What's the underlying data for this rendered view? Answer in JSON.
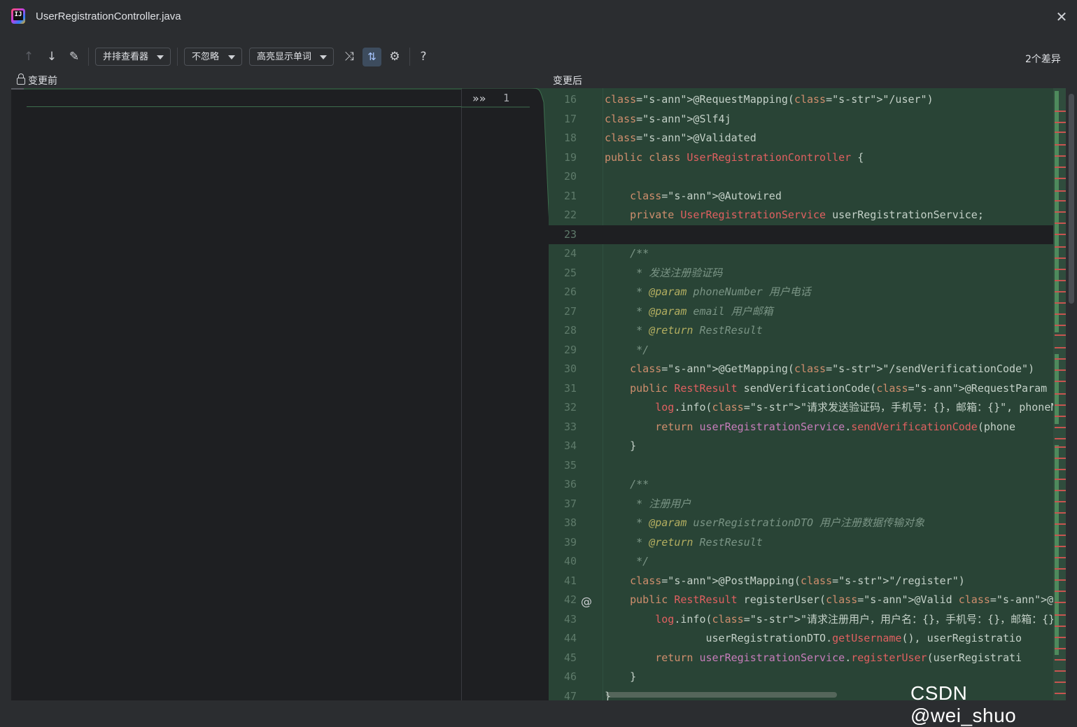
{
  "window": {
    "title": "UserRegistrationController.java",
    "app_icon": "intellij-icon",
    "close_icon": "✕"
  },
  "toolbar": {
    "prev_icon": "↑",
    "next_icon": "↓",
    "edit_icon": "✎",
    "viewer_dropdown": "并排查看器",
    "ignore_dropdown": "不忽略",
    "highlight_dropdown": "高亮显示单词",
    "collapse_icon": "⤨",
    "sync_icon": "⇅",
    "settings_icon": "⚙",
    "help_icon": "?",
    "diff_count": "2个差异"
  },
  "panes": {
    "left_label": "变更前",
    "right_label": "变更后"
  },
  "gutter": {
    "arrows": "»»",
    "change_number": "1"
  },
  "code_lines": [
    {
      "n": "16",
      "text": "@RequestMapping(\"/user\")"
    },
    {
      "n": "17",
      "text": "@Slf4j"
    },
    {
      "n": "18",
      "text": "@Validated"
    },
    {
      "n": "19",
      "text": "public class UserRegistrationController {"
    },
    {
      "n": "20",
      "text": ""
    },
    {
      "n": "21",
      "text": "    @Autowired"
    },
    {
      "n": "22",
      "text": "    private UserRegistrationService userRegistrationService;"
    },
    {
      "n": "23",
      "text": ""
    },
    {
      "n": "24",
      "text": "    /**"
    },
    {
      "n": "25",
      "text": "     * 发送注册验证码"
    },
    {
      "n": "26",
      "text": "     * @param phoneNumber 用户电话"
    },
    {
      "n": "27",
      "text": "     * @param email 用户邮箱"
    },
    {
      "n": "28",
      "text": "     * @return RestResult"
    },
    {
      "n": "29",
      "text": "     */"
    },
    {
      "n": "30",
      "text": "    @GetMapping(\"/sendVerificationCode\")"
    },
    {
      "n": "31",
      "text": "    public RestResult sendVerificationCode(@RequestParam String p"
    },
    {
      "n": "32",
      "text": "        log.info(\"请求发送验证码，手机号：{}，邮箱：{}\", phoneNumber, e"
    },
    {
      "n": "33",
      "text": "        return userRegistrationService.sendVerificationCode(phone"
    },
    {
      "n": "34",
      "text": "    }"
    },
    {
      "n": "35",
      "text": ""
    },
    {
      "n": "36",
      "text": "    /**"
    },
    {
      "n": "37",
      "text": "     * 注册用户"
    },
    {
      "n": "38",
      "text": "     * @param userRegistrationDTO 用户注册数据传输对象"
    },
    {
      "n": "39",
      "text": "     * @return RestResult"
    },
    {
      "n": "40",
      "text": "     */"
    },
    {
      "n": "41",
      "text": "    @PostMapping(\"/register\")"
    },
    {
      "n": "42",
      "text": "    public RestResult registerUser(@Valid @RequestBody UserRegis"
    },
    {
      "n": "43",
      "text": "        log.info(\"请求注册用户，用户名：{}，手机号：{}，邮箱：{}\","
    },
    {
      "n": "44",
      "text": "                userRegistrationDTO.getUsername(), userRegistratio"
    },
    {
      "n": "45",
      "text": "        return userRegistrationService.registerUser(userRegistrati"
    },
    {
      "n": "46",
      "text": "    }"
    },
    {
      "n": "47",
      "text": "}"
    }
  ],
  "gutter_markers": {
    "at_icon": "@"
  },
  "watermark": "CSDN @wei_shuo"
}
